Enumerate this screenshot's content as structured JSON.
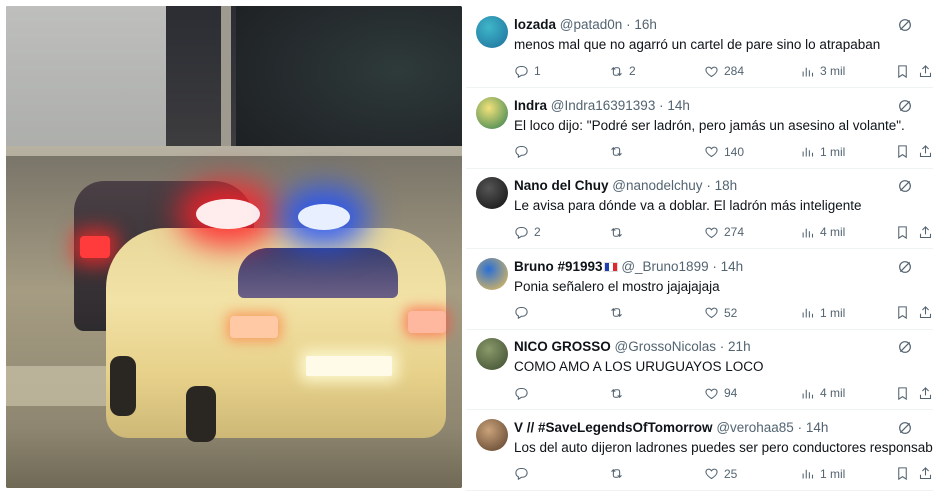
{
  "replies": [
    {
      "name": "lozada",
      "handle": "@patad0n",
      "time": "16h",
      "text": "menos mal que no agarró un cartel de pare sino lo atrapaban",
      "replies": "1",
      "retweets": "2",
      "likes": "284",
      "views": "3 mil",
      "avatar_colors": [
        "#3fb6c9",
        "#1d6f9b"
      ],
      "has_flag": false
    },
    {
      "name": "Indra",
      "handle": "@Indra16391393",
      "time": "14h",
      "text": "El loco dijo: \"Podré ser ladrón, pero jamás un asesino al volante\".",
      "replies": "",
      "retweets": "",
      "likes": "140",
      "views": "1 mil",
      "avatar_colors": [
        "#f3e27a",
        "#2e7d4f"
      ],
      "has_flag": false
    },
    {
      "name": "Nano del Chuy",
      "handle": "@nanodelchuy",
      "time": "18h",
      "text": "Le avisa para dónde va a doblar. El ladrón más inteligente",
      "replies": "2",
      "retweets": "",
      "likes": "274",
      "views": "4 mil",
      "avatar_colors": [
        "#555",
        "#111"
      ],
      "has_flag": false
    },
    {
      "name": "Bruno #91993",
      "handle": "@_Bruno1899",
      "time": "14h",
      "text": "Ponia señalero el mostro jajajajaja",
      "replies": "",
      "retweets": "",
      "likes": "52",
      "views": "1 mil",
      "avatar_colors": [
        "#2a6fd6",
        "#f2c14e"
      ],
      "has_flag": true
    },
    {
      "name": "NICO GROSSO",
      "handle": "@GrossoNicolas",
      "time": "21h",
      "text": "COMO AMO A LOS URUGUAYOS LOCO",
      "replies": "",
      "retweets": "",
      "likes": "94",
      "views": "4 mil",
      "avatar_colors": [
        "#8a9a6a",
        "#3b4a2e"
      ],
      "has_flag": false
    },
    {
      "name": "V // #SaveLegendsOfTomorrow",
      "handle": "@verohaa85",
      "time": "14h",
      "text": "Los del auto dijeron ladrones puedes ser pero conductores responsables.",
      "replies": "",
      "retweets": "",
      "likes": "25",
      "views": "1 mil",
      "avatar_colors": [
        "#c9a27a",
        "#5a3f2a"
      ],
      "has_flag": false
    }
  ],
  "dot": "·",
  "colors": {
    "text": "#0f1419",
    "secondary": "#536471",
    "divider": "#eff3f4"
  }
}
